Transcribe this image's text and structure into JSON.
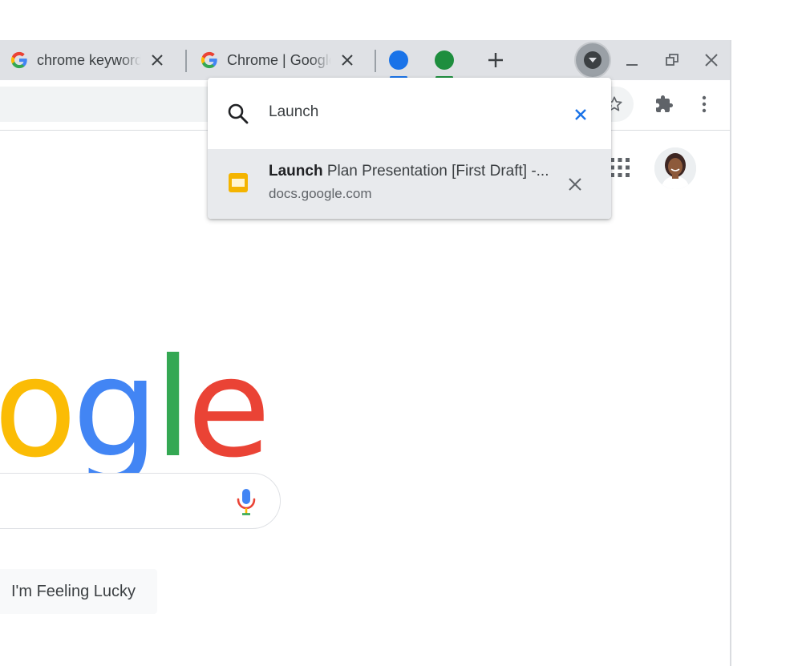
{
  "tabs": [
    {
      "title": "chrome keyword",
      "favicon": "google-g-icon"
    },
    {
      "title": "Chrome | Google",
      "favicon": "google-g-icon"
    }
  ],
  "tab_groups": [
    {
      "color": "#1a73e8"
    },
    {
      "color": "#1e8e3e"
    }
  ],
  "new_tab_icon": "plus-icon",
  "window_controls": [
    "minimize-icon",
    "restore-icon",
    "close-icon"
  ],
  "toolbar_icons": [
    "star-icon",
    "extensions-icon",
    "more-vert-icon"
  ],
  "tab_search": {
    "query": "Launch",
    "results": [
      {
        "title_match": "Launch",
        "title_rest": " Plan Presentation [First Draft] -...",
        "url": "docs.google.com",
        "icon": "google-slides-icon"
      }
    ]
  },
  "page": {
    "logo_letters": [
      "o",
      "g",
      "l",
      "e"
    ],
    "lucky_button": "I'm Feeling Lucky"
  },
  "colors": {
    "google_blue": "#4285f4",
    "google_red": "#ea4335",
    "google_yellow": "#fbbc05",
    "google_green": "#34a853",
    "slides_yellow": "#f4b400"
  }
}
